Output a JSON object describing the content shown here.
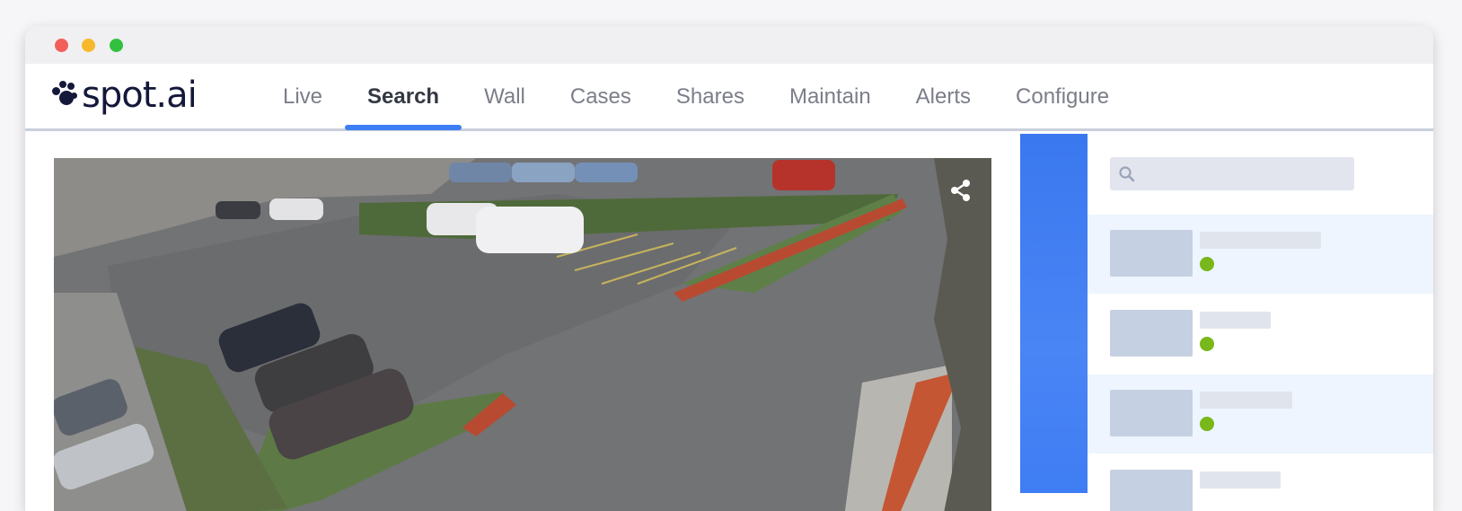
{
  "window": {
    "controls": [
      "close",
      "minimize",
      "maximize"
    ]
  },
  "brand": {
    "logo_text": "spot.ai",
    "logo_icon": "paw-dots-icon"
  },
  "nav": {
    "tabs": [
      {
        "label": "Live",
        "active": false
      },
      {
        "label": "Search",
        "active": true
      },
      {
        "label": "Wall",
        "active": false
      },
      {
        "label": "Cases",
        "active": false
      },
      {
        "label": "Shares",
        "active": false
      },
      {
        "label": "Maintain",
        "active": false
      },
      {
        "label": "Alerts",
        "active": false
      },
      {
        "label": "Configure",
        "active": false
      }
    ]
  },
  "video": {
    "description_icon": "share-icon",
    "scene": "camera-feed-parking-lot"
  },
  "sidebar": {
    "search": {
      "placeholder": "",
      "icon": "search-icon"
    },
    "items": [
      {
        "status": "online",
        "highlighted": true
      },
      {
        "status": "online",
        "highlighted": false
      },
      {
        "status": "online",
        "highlighted": true
      },
      {
        "status": "online",
        "highlighted": false
      }
    ]
  },
  "colors": {
    "accent": "#3d7ef4",
    "brand_dark": "#14183a",
    "status_online": "#78b81a",
    "skeleton": "#e0e4ec",
    "thumb": "#c5d1e2"
  }
}
